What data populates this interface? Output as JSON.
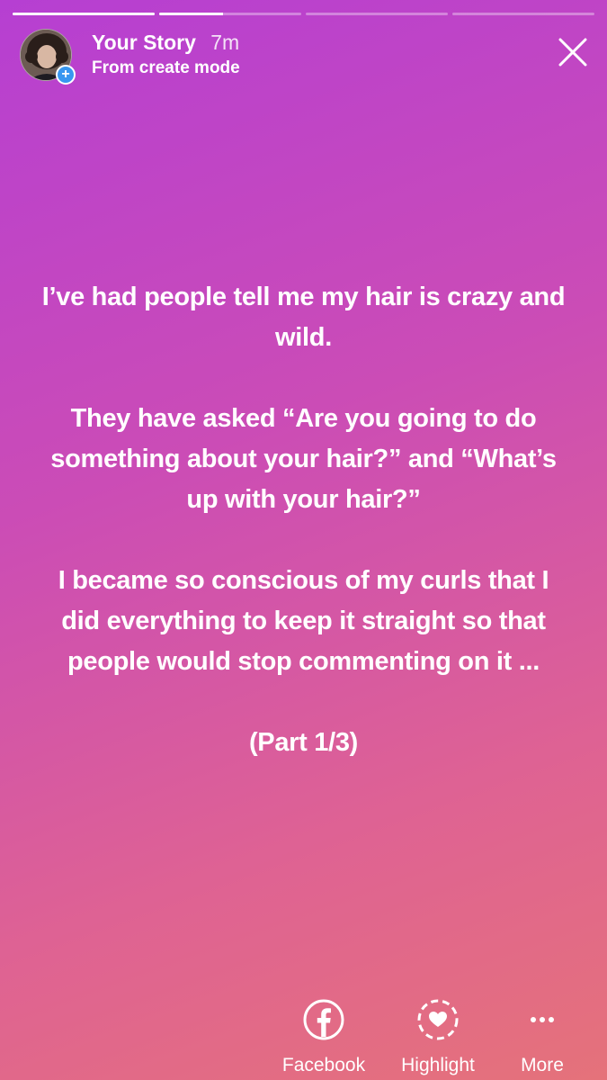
{
  "progress": {
    "segments": [
      {
        "fill": 1.0
      },
      {
        "fill": 0.45
      },
      {
        "fill": 0.0
      },
      {
        "fill": 0.0
      }
    ]
  },
  "header": {
    "title": "Your Story",
    "time": "7m",
    "subtitle": "From create mode",
    "add_badge": "+"
  },
  "story": {
    "paragraphs": [
      "I’ve had people tell me my hair is crazy and wild.",
      "They have asked “Are you going to do something about your hair?” and “What’s up with your hair?”",
      "I became so conscious of my curls that I did everything to keep it straight so that people would stop commenting on it ...",
      "(Part 1/3)"
    ]
  },
  "actions": [
    {
      "label": "Facebook",
      "icon": "facebook-icon"
    },
    {
      "label": "Highlight",
      "icon": "highlight-heart-icon"
    },
    {
      "label": "More",
      "icon": "more-dots-icon"
    }
  ],
  "colors": {
    "gradient_start": "#b63fd2",
    "gradient_end": "#e5727a",
    "badge_blue": "#3897f0"
  }
}
